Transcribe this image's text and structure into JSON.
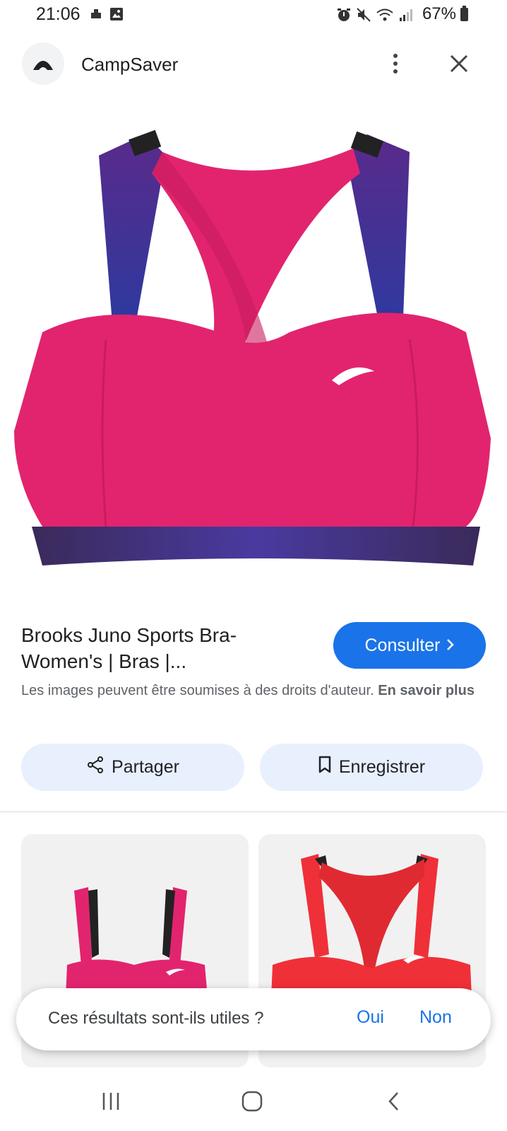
{
  "status_bar": {
    "time": "21:06",
    "battery": "67%",
    "icons": [
      "cloud-icon",
      "image-icon",
      "alarm-icon",
      "mute-icon",
      "wifi-icon",
      "signal-icon",
      "battery-icon"
    ]
  },
  "header": {
    "site_name": "CampSaver",
    "icons": [
      "campsaver-logo-icon",
      "more-vert-icon",
      "close-icon"
    ]
  },
  "product": {
    "title": "Brooks Juno Sports Bra-Women's | Bras |...",
    "consult_label": "Consulter",
    "copyright_text": "Les images peuvent être soumises à des droits d'auteur.",
    "learn_more": "En savoir plus"
  },
  "actions": {
    "share_label": "Partager",
    "save_label": "Enregistrer"
  },
  "feedback": {
    "question": "Ces résultats sont-ils utiles ?",
    "yes": "Oui",
    "no": "Non"
  },
  "colors": {
    "accent": "#1a73e8",
    "chip_bg": "#e8f0fe",
    "product_pink": "#e2246e",
    "product_navy": "#2a2c6b",
    "thumb2_red": "#ef3038"
  }
}
